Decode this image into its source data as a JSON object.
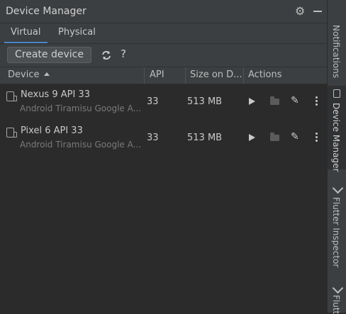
{
  "window": {
    "title": "Device Manager"
  },
  "tabs": [
    {
      "label": "Virtual",
      "active": true
    },
    {
      "label": "Physical",
      "active": false
    }
  ],
  "toolbar": {
    "create_label": "Create device",
    "help_label": "?"
  },
  "table": {
    "columns": [
      "Device",
      "API",
      "Size on D...",
      "Actions"
    ],
    "rows": [
      {
        "name": "Nexus 9 API 33",
        "subtitle": "Android Tiramisu Google A...",
        "api": "33",
        "size": "513 MB"
      },
      {
        "name": "Pixel 6 API 33",
        "subtitle": "Android Tiramisu Google A...",
        "api": "33",
        "size": "513 MB"
      }
    ]
  },
  "sidebar": {
    "tabs": [
      {
        "label": "Notifications"
      },
      {
        "label": "Device Manager"
      },
      {
        "label": "Flutter Inspector"
      },
      {
        "label": "Flutt"
      }
    ]
  },
  "colors": {
    "accent": "#4a88c7",
    "background": "#2b2b2b",
    "chrome": "#3c3f41"
  }
}
